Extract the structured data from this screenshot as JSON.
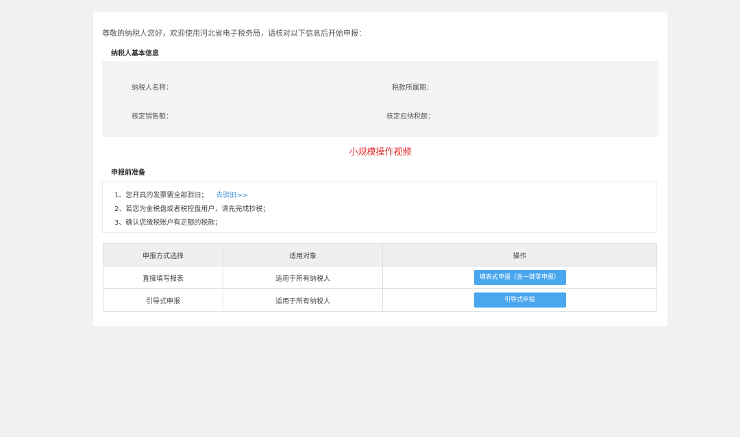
{
  "greeting": "尊敬的纳税人您好，欢迎使用河北省电子税务局，请核对以下信息后开始申报：",
  "basic_info": {
    "title": "纳税人基本信息",
    "taxpayer_name_label": "纳税人名称：",
    "tax_period_label": "税款所属期：",
    "sales_label": "核定销售额：",
    "payable_tax_label": "核定应纳税额："
  },
  "video_link": "小规模操作视频",
  "prep": {
    "title": "申报前准备",
    "item1": "1、您开具的发票需全部验旧；",
    "item1_link": "去验旧>>",
    "item2": "2、若您为金税盘或者税控盘用户，请先完成抄税；",
    "item3": "3、确认您缴税账户有足额的税款；"
  },
  "table": {
    "headers": [
      "申报方式选择",
      "适用对象",
      "操作"
    ],
    "rows": [
      {
        "method": "直接填写报表",
        "target": "适用于所有纳税人",
        "action": "填表式申报（含一键零申报）"
      },
      {
        "method": "引导式申报",
        "target": "适用于所有纳税人",
        "action": "引导式申报"
      }
    ]
  },
  "colors": {
    "accent_button": "#4aa7ee",
    "video_link": "#e02b2b",
    "page_bg": "#f1f1f1"
  }
}
